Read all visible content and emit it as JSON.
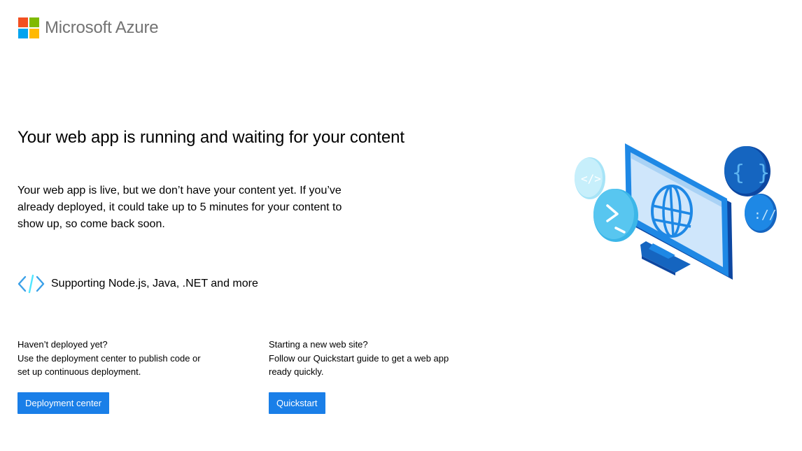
{
  "brand": {
    "name": "Microsoft Azure",
    "colors": [
      "#f25022",
      "#7fba00",
      "#00a4ef",
      "#ffb900"
    ]
  },
  "headline": "Your web app is running and waiting for your content",
  "intro": "Your web app is live, but we don’t have your content yet. If you’ve already deployed, it could take up to 5 minutes for your content to show up, so come back soon.",
  "supporting": {
    "icon": "code-brackets-icon",
    "text": "Supporting Node.js, Java, .NET and more"
  },
  "deploy": {
    "line1": "Haven’t deployed yet?",
    "line2": "Use the deployment center to publish code or set up continuous deployment.",
    "button": "Deployment center"
  },
  "quickstart": {
    "line1": "Starting a new web site?",
    "line2": "Follow our Quickstart guide to get a web app ready quickly.",
    "button": "Quickstart"
  },
  "illustration": {
    "icon": "monitor-globe-illustration",
    "accent": "#1a7fe8"
  }
}
